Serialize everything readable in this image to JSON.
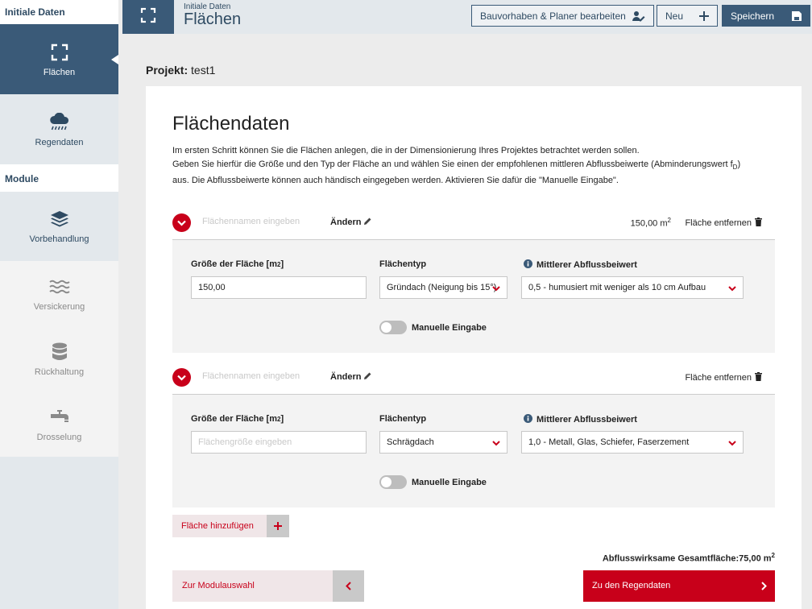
{
  "sidebar": {
    "heading_initial": "Initiale Daten",
    "heading_modules": "Module",
    "items": [
      {
        "label": "Flächen",
        "icon": "expand-icon",
        "state": "active"
      },
      {
        "label": "Regendaten",
        "icon": "rain-cloud-icon",
        "state": "normal"
      },
      {
        "label": "Vorbehandlung",
        "icon": "layers-icon",
        "state": "normal"
      },
      {
        "label": "Versickerung",
        "icon": "waves-icon",
        "state": "disabled"
      },
      {
        "label": "Rückhaltung",
        "icon": "database-icon",
        "state": "disabled"
      },
      {
        "label": "Drosselung",
        "icon": "faucet-icon",
        "state": "disabled"
      }
    ]
  },
  "header": {
    "breadcrumb_sub": "Initiale Daten",
    "title": "Flächen",
    "buttons": {
      "planer": "Bauvorhaben & Planer bearbeiten",
      "neu": "Neu",
      "save": "Speichern"
    }
  },
  "project": {
    "label": "Projekt:",
    "name": "test1"
  },
  "content": {
    "title": "Flächendaten",
    "intro_1": "Im ersten Schritt können Sie die Flächen anlegen, die in der Dimensionierung Ihres Projektes betrachtet werden sollen.",
    "intro_2a": "Geben Sie hierfür die Größe und den Typ der Fläche an und wählen Sie einen der empfohlenen mittleren Abflussbeiwerte (Abminderungswert f",
    "intro_2_sub": "D",
    "intro_2b": ")",
    "intro_3": "aus. Die Abflussbeiwerte können auch händisch eingegeben werden. Aktivieren Sie dafür die \"Manuelle Eingabe\"."
  },
  "labels": {
    "name_placeholder": "Flächennamen eingeben",
    "aendern": "Ändern",
    "remove": "Fläche entfernen",
    "size_label": "Größe der Fläche [m",
    "size_label_sup": "2",
    "size_label_end": "]",
    "size_placeholder": "Flächengröße eingeben",
    "type_label": "Flächentyp",
    "coef_label": "Mittlerer Abflussbeiwert",
    "manual": "Manuelle Eingabe",
    "area_unit": "m",
    "area_unit_sup": "2"
  },
  "areas": [
    {
      "name": "",
      "size_display": "150,00",
      "size_value": "150,00",
      "type": "Gründach (Neigung bis 15°)",
      "coefficient": "0,5 - humusiert mit weniger als 10 cm Aufbau",
      "manual": false
    },
    {
      "name": "",
      "size_display": "",
      "size_value": "",
      "type": "Schrägdach",
      "coefficient": "1,0 - Metall, Glas, Schiefer, Faserzement",
      "manual": false
    }
  ],
  "actions": {
    "add_area": "Fläche hinzufügen",
    "total_label": "Abflusswirksame Gesamtfläche:",
    "total_value": "75,00",
    "back": "Zur Modulauswahl",
    "next": "Zu den Regendaten"
  },
  "colors": {
    "navy": "#3a5a78",
    "red": "#c8001a",
    "sidebar_bg": "#e3e8ec"
  }
}
